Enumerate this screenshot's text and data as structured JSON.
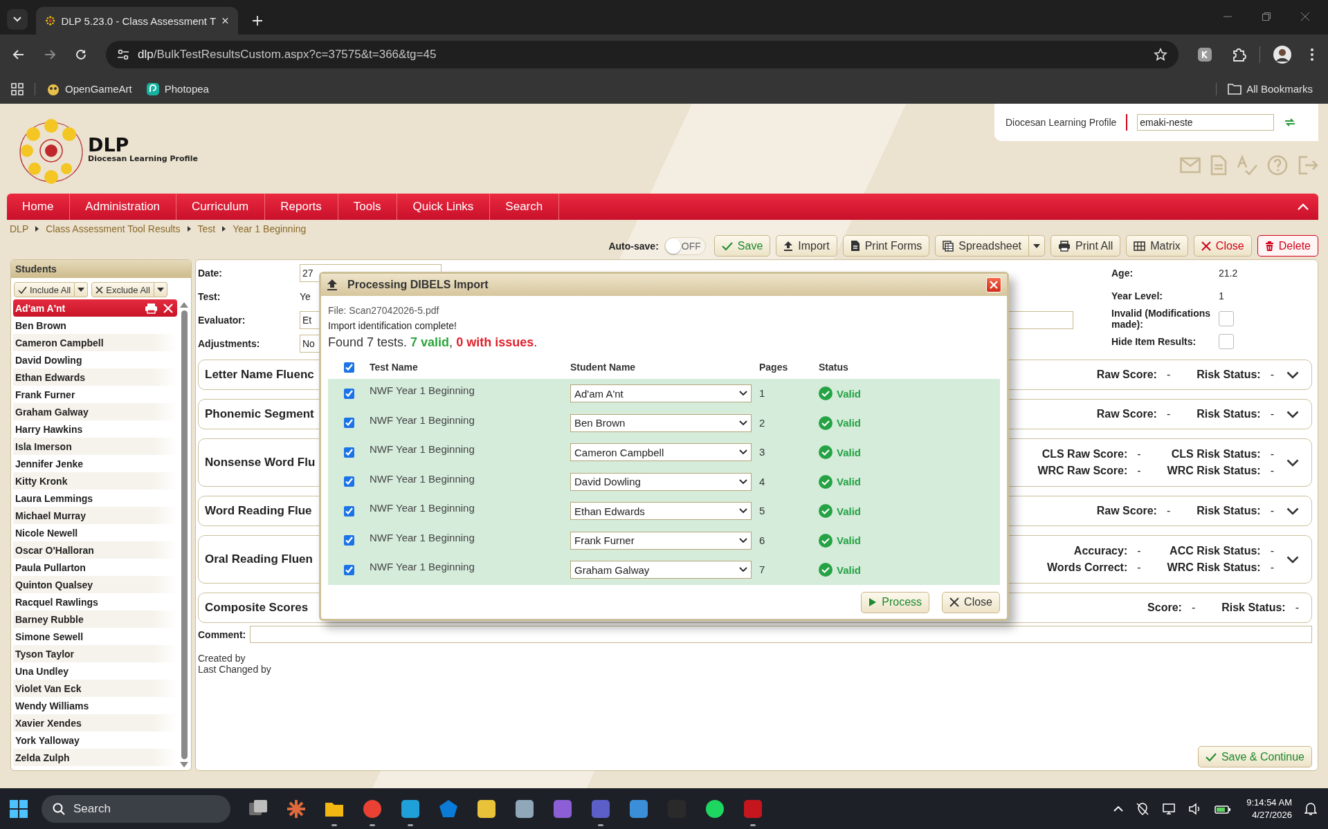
{
  "browser": {
    "tab": {
      "title": "DLP 5.23.0 - Class Assessment T"
    },
    "url": {
      "host": "dlp",
      "path": "/BulkTestResultsCustom.aspx?c=37575&t=366&tg=45"
    },
    "bookmarks": [
      {
        "label": "OpenGameArt"
      },
      {
        "label": "Photopea"
      }
    ],
    "all_bookmarks": "All Bookmarks"
  },
  "header": {
    "logo": {
      "title": "DLP",
      "subtitle": "Diocesan Learning Profile"
    },
    "site_name": "Diocesan Learning Profile",
    "user_field": {
      "value": "emaki-neste"
    }
  },
  "nav": [
    "Home",
    "Administration",
    "Curriculum",
    "Reports",
    "Tools",
    "Quick Links",
    "Search"
  ],
  "breadcrumb": [
    "DLP",
    "Class Assessment Tool Results",
    "Test",
    "Year 1 Beginning"
  ],
  "toolbar": {
    "autosave": {
      "label": "Auto-save:",
      "on": false,
      "state_text": "OFF"
    },
    "buttons": [
      {
        "label": "Save",
        "kind": "save",
        "dropdown": false
      },
      {
        "label": "Import",
        "kind": "import",
        "dropdown": false
      },
      {
        "label": "Print Forms",
        "kind": "print-forms",
        "dropdown": false
      },
      {
        "label": "Spreadsheet",
        "kind": "spreadsheet",
        "dropdown": true
      },
      {
        "label": "Print All",
        "kind": "print-all",
        "dropdown": false
      },
      {
        "label": "Matrix",
        "kind": "matrix",
        "dropdown": false
      },
      {
        "label": "Close",
        "kind": "close",
        "dropdown": false
      },
      {
        "label": "Delete",
        "kind": "delete",
        "dropdown": false
      }
    ]
  },
  "students": {
    "title": "Students",
    "include_all": "Include All",
    "exclude_all": "Exclude All",
    "items": [
      {
        "name": "Ad'am A'nt",
        "selected": true
      },
      {
        "name": "Ben Brown",
        "selected": false
      },
      {
        "name": "Cameron Campbell",
        "selected": false
      },
      {
        "name": "David Dowling",
        "selected": false
      },
      {
        "name": "Ethan Edwards",
        "selected": false
      },
      {
        "name": "Frank Furner",
        "selected": false
      },
      {
        "name": "Graham Galway",
        "selected": false
      },
      {
        "name": "Harry Hawkins",
        "selected": false
      },
      {
        "name": "Isla Imerson",
        "selected": false
      },
      {
        "name": "Jennifer Jenke",
        "selected": false
      },
      {
        "name": "Kitty Kronk",
        "selected": false
      },
      {
        "name": "Laura Lemmings",
        "selected": false
      },
      {
        "name": "Michael Murray",
        "selected": false
      },
      {
        "name": "Nicole Newell",
        "selected": false
      },
      {
        "name": "Oscar O'Halloran",
        "selected": false
      },
      {
        "name": "Paula Pullarton",
        "selected": false
      },
      {
        "name": "Quinton Qualsey",
        "selected": false
      },
      {
        "name": "Racquel Rawlings",
        "selected": false
      },
      {
        "name": "Barney Rubble",
        "selected": false
      },
      {
        "name": "Simone Sewell",
        "selected": false
      },
      {
        "name": "Tyson Taylor",
        "selected": false
      },
      {
        "name": "Una Undley",
        "selected": false
      },
      {
        "name": "Violet Van Eck",
        "selected": false
      },
      {
        "name": "Wendy Williams",
        "selected": false
      },
      {
        "name": "Xavier Xendes",
        "selected": false
      },
      {
        "name": "York Yalloway",
        "selected": false
      },
      {
        "name": "Zelda Zulph",
        "selected": false
      }
    ]
  },
  "form": {
    "fields": [
      {
        "label": "Date:",
        "value": "27",
        "kind": "input"
      },
      {
        "label": "Test:",
        "value": "Ye",
        "kind": "text"
      },
      {
        "label": "Evaluator:",
        "value": "Et",
        "kind": "wide-input"
      },
      {
        "label": "Adjustments:",
        "value": "No",
        "kind": "input"
      }
    ],
    "info": [
      {
        "label": "Age:",
        "value": "21.2",
        "kind": "text"
      },
      {
        "label": "Year Level:",
        "value": "1",
        "kind": "text"
      },
      {
        "label": "Invalid (Modifications made):",
        "checked": false,
        "kind": "checkbox"
      },
      {
        "label": "Hide Item Results:",
        "checked": false,
        "kind": "checkbox"
      }
    ],
    "sections": [
      {
        "title": "Letter Name Fluenc",
        "collapsible": true,
        "scores": [
          [
            {
              "label": "Raw Score:",
              "value": "-"
            },
            {
              "label": "Risk Status:",
              "value": "-"
            }
          ]
        ]
      },
      {
        "title": "Phonemic Segment",
        "collapsible": true,
        "scores": [
          [
            {
              "label": "Raw Score:",
              "value": "-"
            },
            {
              "label": "Risk Status:",
              "value": "-"
            }
          ]
        ]
      },
      {
        "title": "Nonsense Word Flu",
        "collapsible": true,
        "scores": [
          [
            {
              "label": "CLS Raw Score:",
              "value": "-"
            },
            {
              "label": "CLS Risk Status:",
              "value": "-"
            }
          ],
          [
            {
              "label": "WRC Raw Score:",
              "value": "-"
            },
            {
              "label": "WRC Risk Status:",
              "value": "-"
            }
          ]
        ]
      },
      {
        "title": "Word Reading Flue",
        "collapsible": true,
        "scores": [
          [
            {
              "label": "Raw Score:",
              "value": "-"
            },
            {
              "label": "Risk Status:",
              "value": "-"
            }
          ]
        ]
      },
      {
        "title": "Oral Reading Fluen",
        "collapsible": true,
        "scores": [
          [
            {
              "label": "Accuracy:",
              "value": "-"
            },
            {
              "label": "ACC Risk Status:",
              "value": "-"
            }
          ],
          [
            {
              "label": "Words Correct:",
              "value": "-"
            },
            {
              "label": "WRC Risk Status:",
              "value": "-"
            }
          ]
        ]
      },
      {
        "title": "Composite Scores",
        "collapsible": false,
        "scores": [
          [
            {
              "label": "Score:",
              "value": "-"
            },
            {
              "label": "Risk Status:",
              "value": "-"
            }
          ]
        ]
      }
    ],
    "comment": {
      "label": "Comment:"
    },
    "created_by": "Created by",
    "last_changed_by": "Last Changed by",
    "save_continue": "Save & Continue"
  },
  "modal": {
    "title": "Processing DIBELS Import",
    "file": "File: Scan27042026-5.pdf",
    "message": "Import identification complete!",
    "summary": {
      "found": "Found 7 tests.",
      "valid": "7 valid",
      "separator": ",",
      "issues": "0 with issues",
      "end": "."
    },
    "select_all": true,
    "columns": [
      "Test Name",
      "Student Name",
      "Pages",
      "Status"
    ],
    "rows": [
      {
        "checked": true,
        "test": "NWF Year 1 Beginning",
        "student": "Ad'am A'nt",
        "pages": "1",
        "status": "Valid",
        "kind": "valid"
      },
      {
        "checked": true,
        "test": "NWF Year 1 Beginning",
        "student": "Ben Brown",
        "pages": "2",
        "status": "Valid",
        "kind": "valid"
      },
      {
        "checked": true,
        "test": "NWF Year 1 Beginning",
        "student": "Cameron Campbell",
        "pages": "3",
        "status": "Valid",
        "kind": "valid"
      },
      {
        "checked": true,
        "test": "NWF Year 1 Beginning",
        "student": "David Dowling",
        "pages": "4",
        "status": "Valid",
        "kind": "valid"
      },
      {
        "checked": true,
        "test": "NWF Year 1 Beginning",
        "student": "Ethan Edwards",
        "pages": "5",
        "status": "Valid",
        "kind": "valid"
      },
      {
        "checked": true,
        "test": "NWF Year 1 Beginning",
        "student": "Frank Furner",
        "pages": "6",
        "status": "Valid",
        "kind": "valid"
      },
      {
        "checked": true,
        "test": "NWF Year 1 Beginning",
        "student": "Graham Galway",
        "pages": "7",
        "status": "Valid",
        "kind": "valid"
      }
    ],
    "buttons": [
      {
        "label": "Process",
        "kind": "process"
      },
      {
        "label": "Close",
        "kind": "close"
      }
    ]
  },
  "taskbar": {
    "search": "Search",
    "apps": [
      {
        "running": false
      },
      {
        "running": false
      },
      {
        "running": true
      },
      {
        "running": true
      },
      {
        "running": true
      },
      {
        "running": false
      },
      {
        "running": false
      },
      {
        "running": false
      },
      {
        "running": false
      },
      {
        "running": true
      },
      {
        "running": false
      },
      {
        "running": false
      },
      {
        "running": false
      },
      {
        "running": true
      }
    ],
    "time": "9:14:54 AM",
    "date": "4/27/2026"
  }
}
